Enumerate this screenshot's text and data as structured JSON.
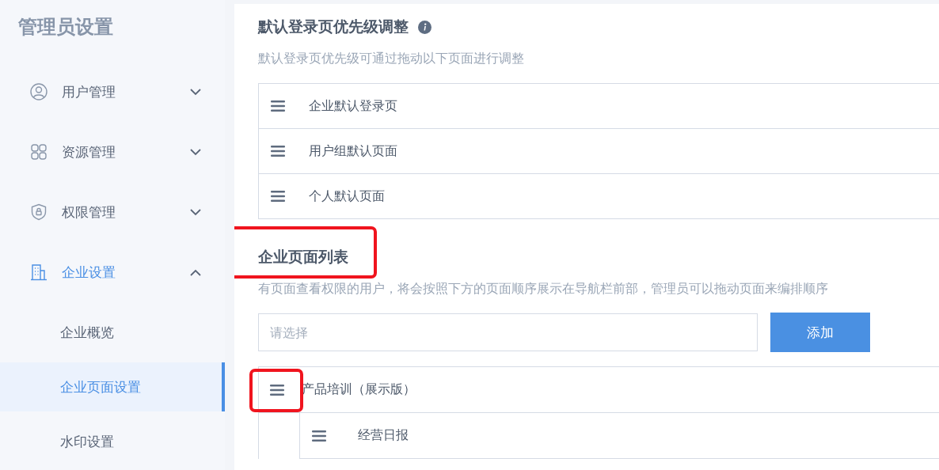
{
  "sidebar": {
    "title": "管理员设置",
    "items": [
      {
        "label": "用户管理",
        "expanded": false,
        "selected": false
      },
      {
        "label": "资源管理",
        "expanded": false,
        "selected": false
      },
      {
        "label": "权限管理",
        "expanded": false,
        "selected": false
      },
      {
        "label": "企业设置",
        "expanded": true,
        "selected": true,
        "children": [
          {
            "label": "企业概览",
            "selected": false
          },
          {
            "label": "企业页面设置",
            "selected": true
          },
          {
            "label": "水印设置",
            "selected": false
          }
        ]
      }
    ]
  },
  "priority": {
    "title": "默认登录页优先级调整",
    "description": "默认登录页优先级可通过拖动以下页面进行调整",
    "items": [
      {
        "label": "企业默认登录页"
      },
      {
        "label": "用户组默认页面"
      },
      {
        "label": "个人默认页面"
      }
    ]
  },
  "page_list": {
    "title": "企业页面列表",
    "title_highlighted": true,
    "description": "有页面查看权限的用户，将会按照下方的页面顺序展示在导航栏前部，管理员可以拖动页面来编排顺序",
    "select": {
      "placeholder": "请选择"
    },
    "add_button": "添加",
    "items": [
      {
        "label": "产品培训（展示版）",
        "handle_highlighted": true,
        "children": [
          {
            "label": "经营日报"
          }
        ]
      }
    ]
  }
}
